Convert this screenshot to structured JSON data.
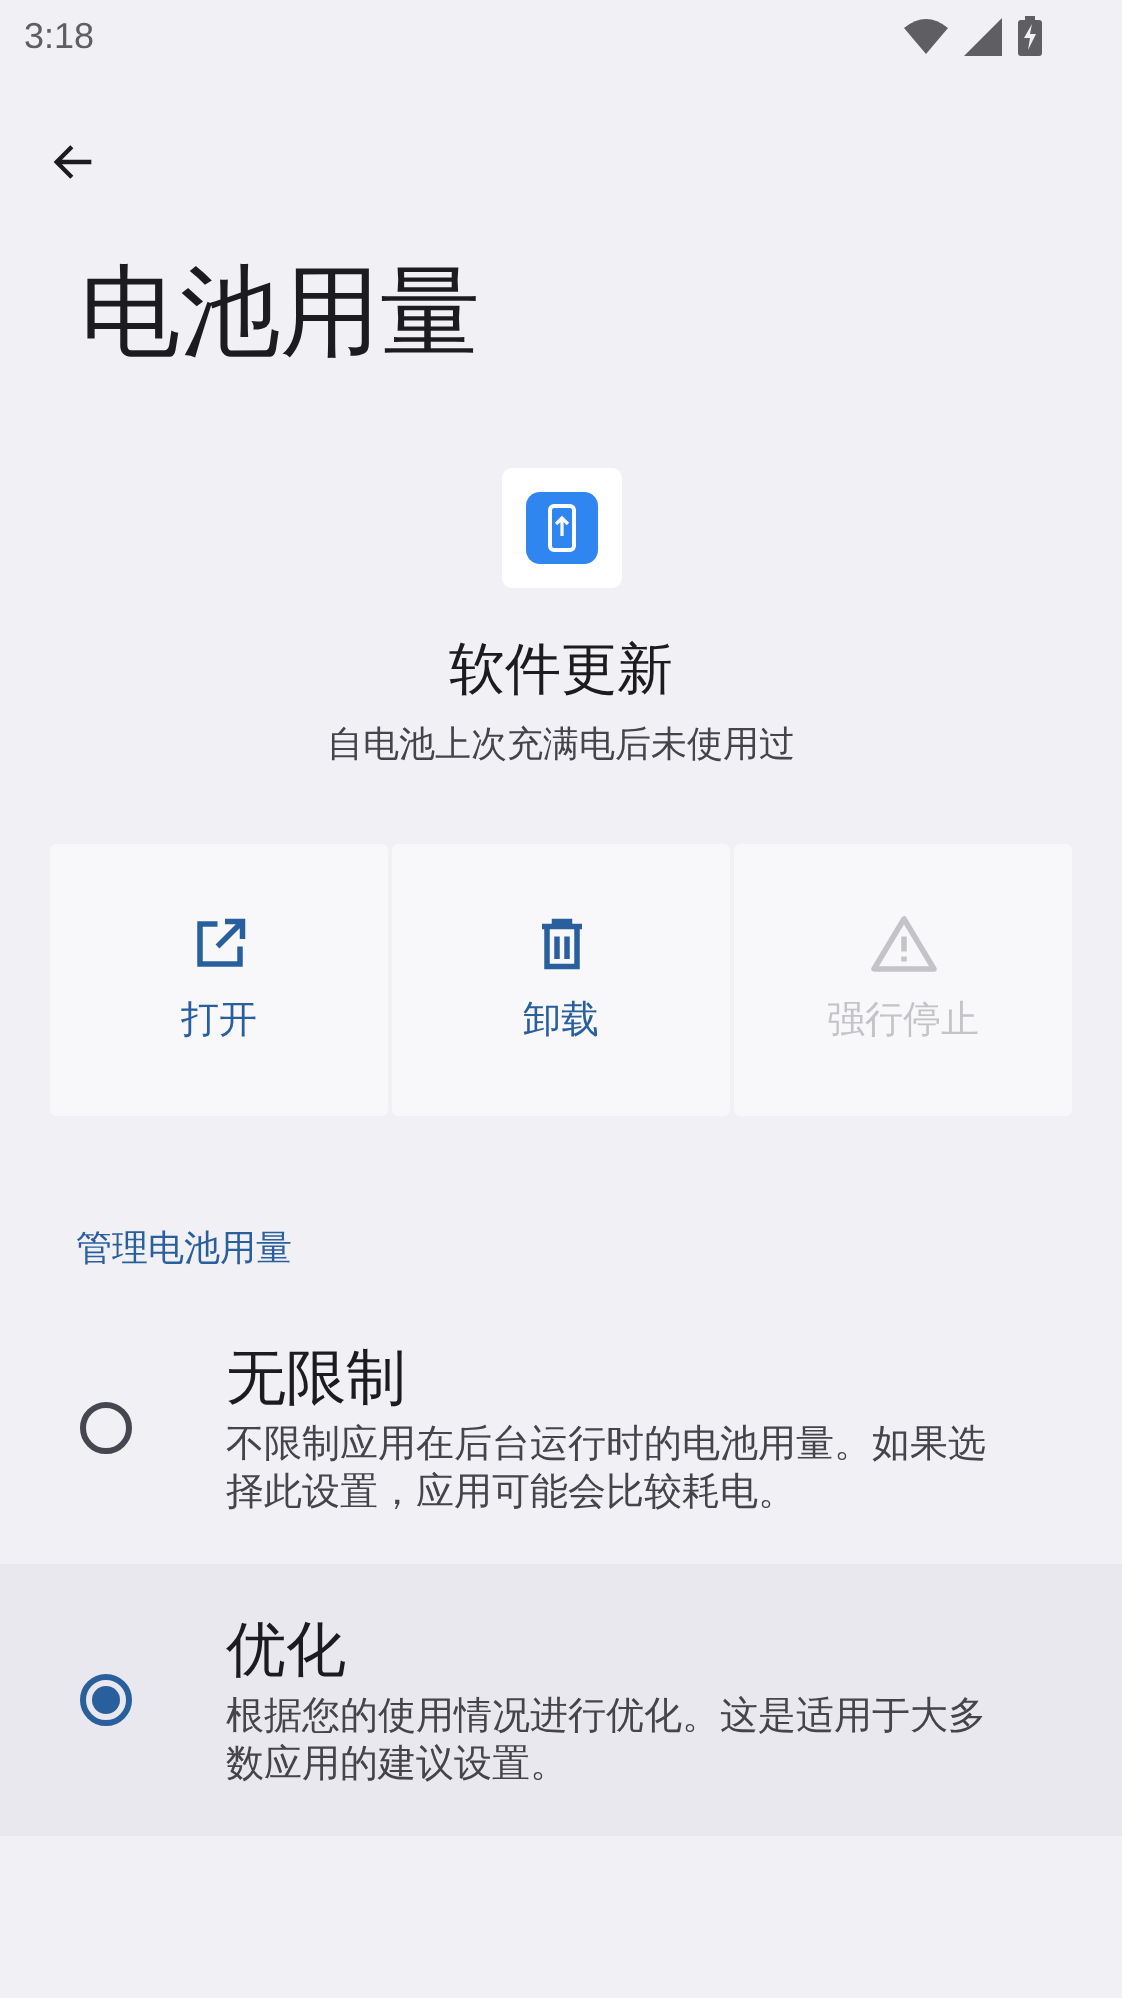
{
  "status_bar": {
    "time": "3:18"
  },
  "title": "电池用量",
  "app": {
    "name": "软件更新",
    "summary": "自电池上次充满电后未使用过"
  },
  "actions": [
    {
      "kind": "open",
      "label": "打开",
      "disabled": false
    },
    {
      "kind": "uninstall",
      "label": "卸载",
      "disabled": false
    },
    {
      "kind": "force_stop",
      "label": "强行停止",
      "disabled": true
    }
  ],
  "section": {
    "header": "管理电池用量",
    "options": [
      {
        "title": "无限制",
        "description": "不限制应用在后台运行时的电池用量。如果选择此设置，应用可能会比较耗电。",
        "selected": false
      },
      {
        "title": "优化",
        "description": "根据您的使用情况进行优化。这是适用于大多数应用的建议设置。",
        "selected": true
      }
    ]
  }
}
